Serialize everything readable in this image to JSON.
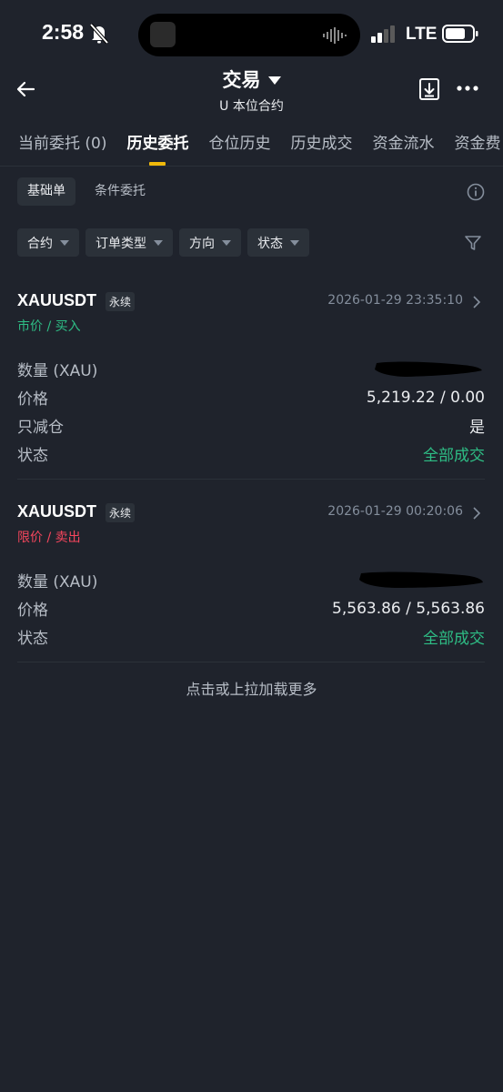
{
  "status_bar": {
    "time": "2:58",
    "network": "LTE"
  },
  "header": {
    "title": "交易",
    "subtitle": "U 本位合约"
  },
  "tabs": [
    {
      "label": "当前委托 (0)",
      "active": false
    },
    {
      "label": "历史委托",
      "active": true
    },
    {
      "label": "仓位历史",
      "active": false
    },
    {
      "label": "历史成交",
      "active": false
    },
    {
      "label": "资金流水",
      "active": false
    },
    {
      "label": "资金费",
      "active": false
    }
  ],
  "segments": [
    {
      "label": "基础单",
      "active": true
    },
    {
      "label": "条件委托",
      "active": false
    }
  ],
  "filters": [
    "合约",
    "订单类型",
    "方向",
    "状态"
  ],
  "orders": [
    {
      "symbol": "XAUUSDT",
      "tag": "永续",
      "time": "2026-01-29 23:35:10",
      "side": "市价 / 买入",
      "rows": [
        {
          "label": "数量 (XAU)",
          "value": ""
        },
        {
          "label": "价格",
          "value": "5,219.22 / 0.00"
        },
        {
          "label": "只减仓",
          "value": "是"
        },
        {
          "label": "状态",
          "value": "全部成交"
        }
      ]
    },
    {
      "symbol": "XAUUSDT",
      "tag": "永续",
      "time": "2026-01-29 00:20:06",
      "side": "限价 / 卖出",
      "rows": [
        {
          "label": "数量 (XAU)",
          "value": ""
        },
        {
          "label": "价格",
          "value": "5,563.86 / 5,563.86"
        },
        {
          "label": "状态",
          "value": "全部成交"
        }
      ]
    }
  ],
  "load_more": "点击或上拉加载更多",
  "colors": {
    "accent": "#f0b90b",
    "buy": "#2ebd85",
    "sell": "#f6465d",
    "background": "#1f232c"
  }
}
